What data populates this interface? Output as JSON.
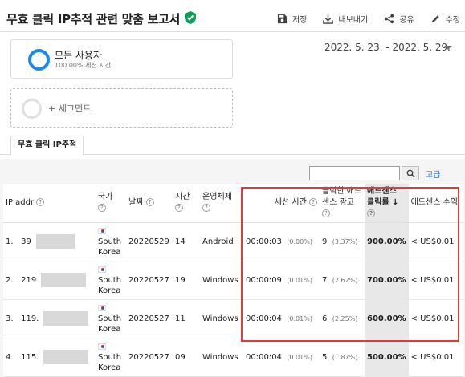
{
  "header": {
    "title": "무효 클릭 IP추적 관련 맞춤 보고서",
    "save_label": "저장",
    "export_label": "내보내기",
    "share_label": "공유",
    "edit_label": "수정"
  },
  "segments": {
    "active": {
      "name": "모든 사용자",
      "sub": "100.00% 세션 시간"
    },
    "add_label": "+ 세그먼트"
  },
  "date_range": "2022. 5. 23. - 2022. 5. 29.",
  "tabs": [
    {
      "label": "무효 클릭 IP추적"
    }
  ],
  "search": {
    "placeholder": "",
    "advanced_label": "고급"
  },
  "table": {
    "headers": {
      "ip": "IP addr",
      "country": "국가",
      "date": "날짜",
      "hour": "시간",
      "os": "운영체제",
      "session": "세션 시간",
      "clicks": "클릭한 애드센스 광고",
      "ctr": "애드센스 클릭률",
      "revenue": "애드센스 수익"
    },
    "rows": [
      {
        "idx": "1.",
        "ip": "39",
        "country1": "South",
        "country2": "Korea",
        "date": "20220529",
        "hour": "14",
        "os": "Android",
        "session": "00:00:03",
        "session_pct": "(0.00%)",
        "clicks": "9",
        "clicks_pct": "(3.37%)",
        "ctr": "900.00%",
        "revenue": "< US$0.01"
      },
      {
        "idx": "2.",
        "ip": "219",
        "country1": "South",
        "country2": "Korea",
        "date": "20220527",
        "hour": "19",
        "os": "Windows",
        "session": "00:00:09",
        "session_pct": "(0.01%)",
        "clicks": "7",
        "clicks_pct": "(2.62%)",
        "ctr": "700.00%",
        "revenue": "< US$0.01"
      },
      {
        "idx": "3.",
        "ip": "119.",
        "country1": "South",
        "country2": "Korea",
        "date": "20220527",
        "hour": "11",
        "os": "Windows",
        "session": "00:00:04",
        "session_pct": "(0.01%)",
        "clicks": "6",
        "clicks_pct": "(2.25%)",
        "ctr": "600.00%",
        "revenue": "< US$0.01"
      },
      {
        "idx": "4.",
        "ip": "115.",
        "country1": "South",
        "country2": "Korea",
        "date": "20220527",
        "hour": "09",
        "os": "Windows",
        "session": "00:00:04",
        "session_pct": "(0.01%)",
        "clicks": "5",
        "clicks_pct": "(1.87%)",
        "ctr": "500.00%",
        "revenue": "< US$0.01"
      }
    ]
  },
  "colors": {
    "accent": "#1e88e5",
    "highlight": "#e53935",
    "verified": "#0f9d58",
    "link": "#1a73e8"
  }
}
